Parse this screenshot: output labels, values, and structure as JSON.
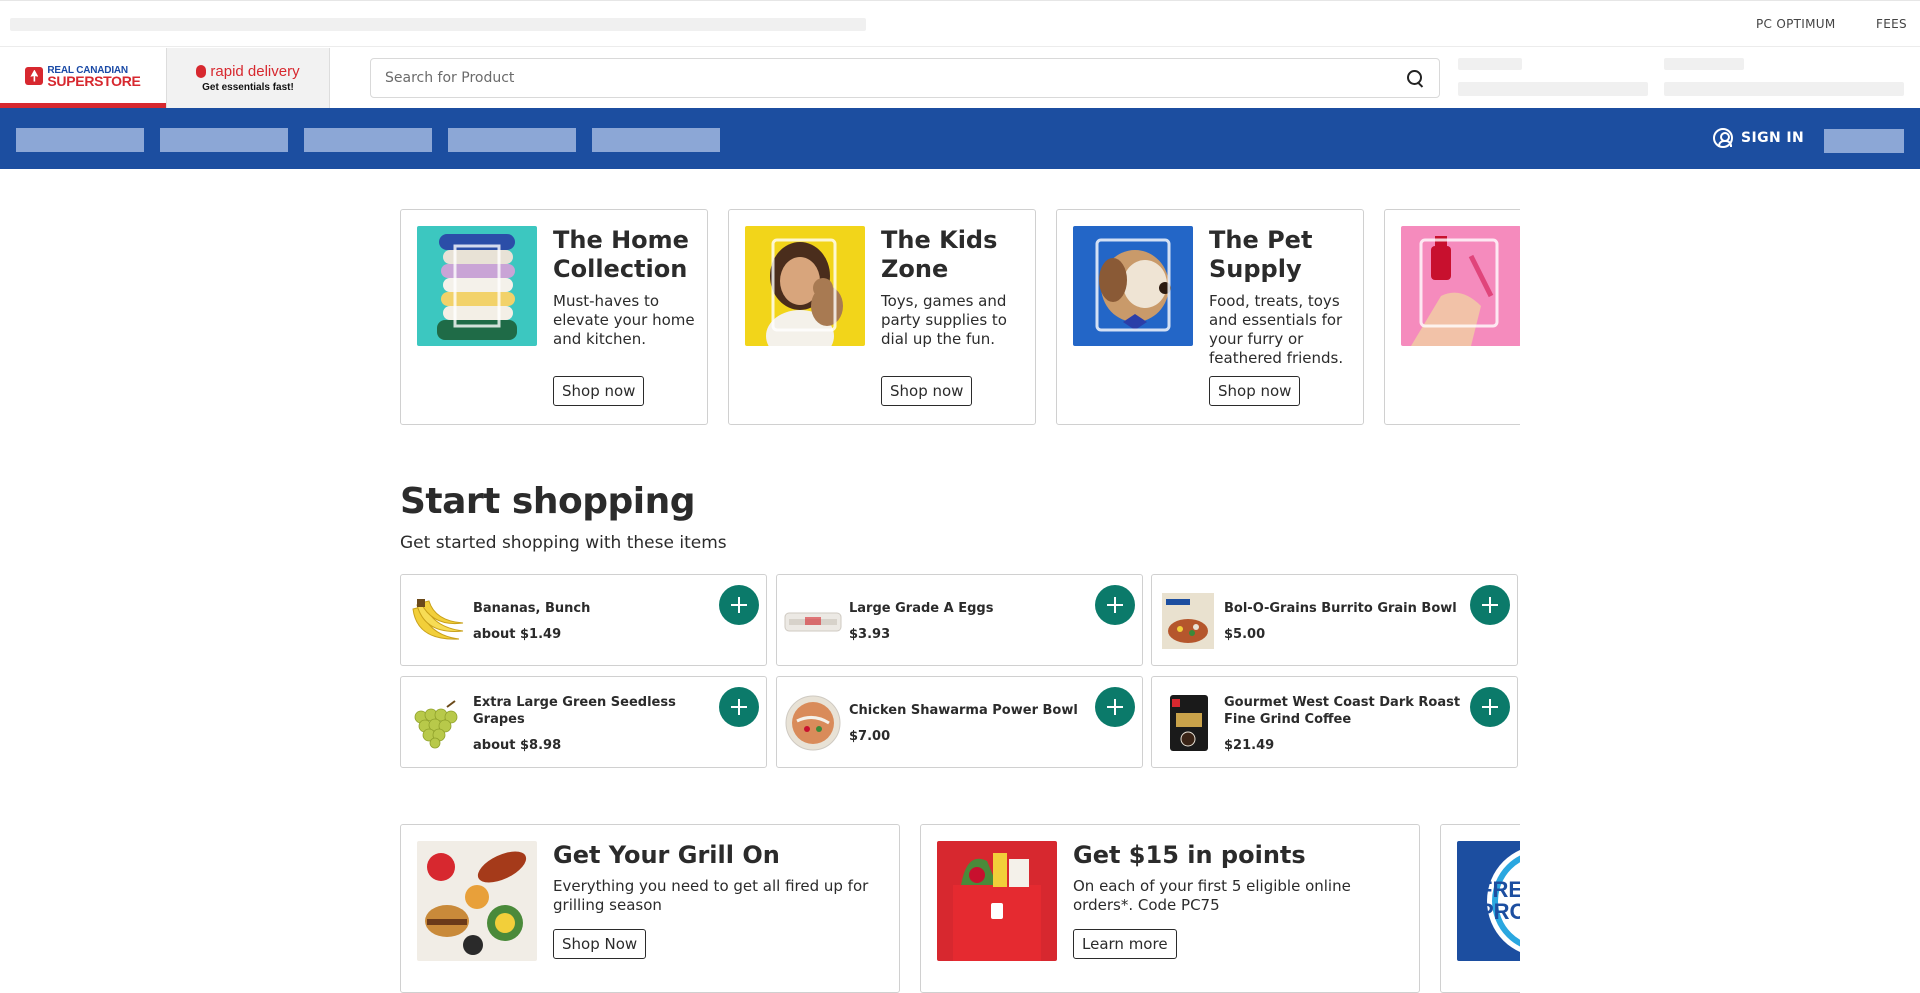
{
  "utility": {
    "links": [
      "PC OPTIMUM",
      "FEES"
    ]
  },
  "header": {
    "logo": {
      "line1": "REAL CANADIAN",
      "line2": "SUPERSTORE"
    },
    "rapid": {
      "title": "rapid delivery",
      "subtitle": "Get essentials fast!"
    },
    "search": {
      "placeholder": "Search for Product"
    }
  },
  "nav": {
    "sign_in": "SIGN IN"
  },
  "promos": [
    {
      "title": "The Home Collection",
      "desc": "Must-haves to elevate your home and kitchen.",
      "button": "Shop now",
      "color": "#3cc7c0"
    },
    {
      "title": "The Kids Zone",
      "desc": "Toys, games and party supplies to dial up the fun.",
      "button": "Shop now",
      "color": "#f2d51a"
    },
    {
      "title": "The Pet Supply",
      "desc": "Food, treats, toys and essentials for your furry or feathered friends.",
      "button": "Shop now",
      "color": "#2366c7"
    },
    {
      "title": "",
      "desc": "",
      "button": "",
      "color": "#f58bbd"
    }
  ],
  "start_shopping": {
    "title": "Start shopping",
    "subtitle": "Get started shopping with these items",
    "products": [
      {
        "name": "Bananas, Bunch",
        "price": "about $1.49"
      },
      {
        "name": "Large Grade A Eggs",
        "price": "$3.93"
      },
      {
        "name": "Bol-O-Grains Burrito Grain Bowl",
        "price": "$5.00"
      },
      {
        "name": "Extra Large Green Seedless Grapes",
        "price": "about $8.98"
      },
      {
        "name": "Chicken Shawarma Power Bowl",
        "price": "$7.00"
      },
      {
        "name": "Gourmet West Coast Dark Roast Fine Grind Coffee",
        "price": "$21.49"
      }
    ]
  },
  "banners": [
    {
      "title": "Get Your Grill On",
      "desc": "Everything you need to get all fired up for grilling season",
      "button": "Shop Now"
    },
    {
      "title": "Get $15 in points",
      "desc": "On each of your first 5 eligible online orders*. Code PC75",
      "button": "Learn more"
    },
    {
      "title": "",
      "desc": "",
      "button": "",
      "image_text": "FRE PRO"
    }
  ],
  "colors": {
    "brand_blue": "#1c4ea0",
    "brand_red": "#d7282f",
    "add_green": "#0b7a6a"
  }
}
